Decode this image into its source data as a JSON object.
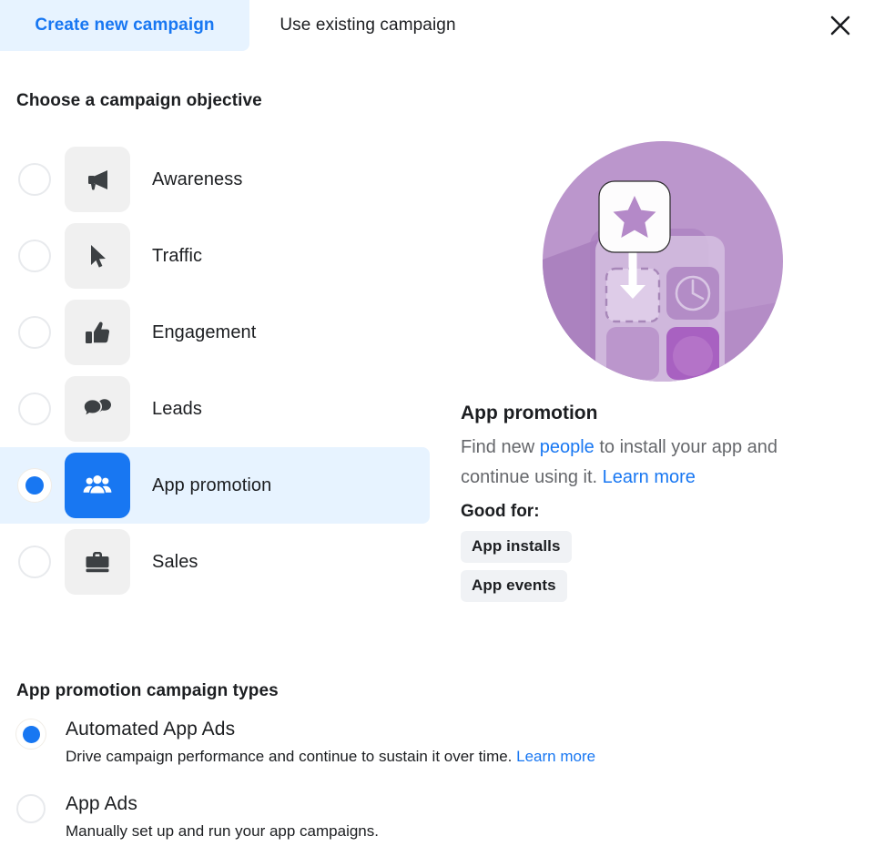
{
  "tabs": {
    "create": "Create new campaign",
    "existing": "Use existing campaign",
    "close_icon": "close-icon"
  },
  "objective_section": {
    "title": "Choose a campaign objective",
    "items": [
      {
        "label": "Awareness",
        "icon": "megaphone-icon",
        "selected": false
      },
      {
        "label": "Traffic",
        "icon": "cursor-icon",
        "selected": false
      },
      {
        "label": "Engagement",
        "icon": "thumbs-up-icon",
        "selected": false
      },
      {
        "label": "Leads",
        "icon": "chat-bubbles-icon",
        "selected": false
      },
      {
        "label": "App promotion",
        "icon": "people-icon",
        "selected": true
      },
      {
        "label": "Sales",
        "icon": "briefcase-icon",
        "selected": false
      }
    ]
  },
  "detail": {
    "illustration": "app-promotion-illustration",
    "title": "App promotion",
    "desc_part1": "Find new ",
    "desc_link1": "people",
    "desc_part2": " to install your app and continue using it. ",
    "desc_link2": "Learn more",
    "good_for_label": "Good for:",
    "tags": [
      "App installs",
      "App events"
    ]
  },
  "types_section": {
    "title": "App promotion campaign types",
    "items": [
      {
        "name": "Automated App Ads",
        "desc": "Drive campaign performance and continue to sustain it over time. ",
        "link": "Learn more",
        "selected": true
      },
      {
        "name": "App Ads",
        "desc": "Manually set up and run your app campaigns.",
        "link": "",
        "selected": false
      }
    ]
  },
  "colors": {
    "accent_blue": "#1877f2",
    "tab_highlight": "#e7f3ff",
    "row_highlight": "#e7f3ff",
    "tile_gray": "#f0f0f0",
    "tag_gray": "#f0f2f5",
    "text_primary": "#1c1e21",
    "text_secondary": "#65676b",
    "illustration_purple": "#b089c4"
  }
}
